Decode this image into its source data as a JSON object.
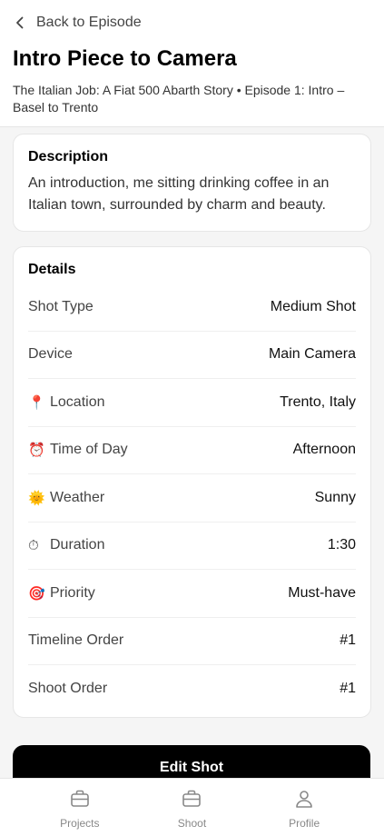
{
  "header": {
    "back_label": "Back to Episode",
    "title": "Intro Piece to Camera",
    "subtitle": "The Italian Job: A Fiat 500 Abarth Story • Episode 1: Intro – Basel to Trento"
  },
  "description": {
    "heading": "Description",
    "text": "An introduction, me sitting drinking coffee in an Italian town, surrounded by charm and beauty."
  },
  "details": {
    "heading": "Details",
    "rows": [
      {
        "icon": "",
        "label": "Shot Type",
        "value": "Medium Shot"
      },
      {
        "icon": "",
        "label": "Device",
        "value": "Main Camera"
      },
      {
        "icon": "📍",
        "label": "Location",
        "value": "Trento, Italy"
      },
      {
        "icon": "⏰",
        "label": "Time of Day",
        "value": "Afternoon"
      },
      {
        "icon": "🌞",
        "label": "Weather",
        "value": "Sunny"
      },
      {
        "icon": "⏱",
        "label": "Duration",
        "value": "1:30"
      },
      {
        "icon": "🎯",
        "label": "Priority",
        "value": "Must-have"
      },
      {
        "icon": "",
        "label": "Timeline Order",
        "value": "#1"
      },
      {
        "icon": "",
        "label": "Shoot Order",
        "value": "#1"
      }
    ]
  },
  "edit_button": "Edit Shot",
  "tabbar": {
    "tabs": [
      {
        "label": "Projects",
        "icon": "briefcase-icon"
      },
      {
        "label": "Shoot",
        "icon": "briefcase-icon"
      },
      {
        "label": "Profile",
        "icon": "person-icon"
      }
    ]
  }
}
